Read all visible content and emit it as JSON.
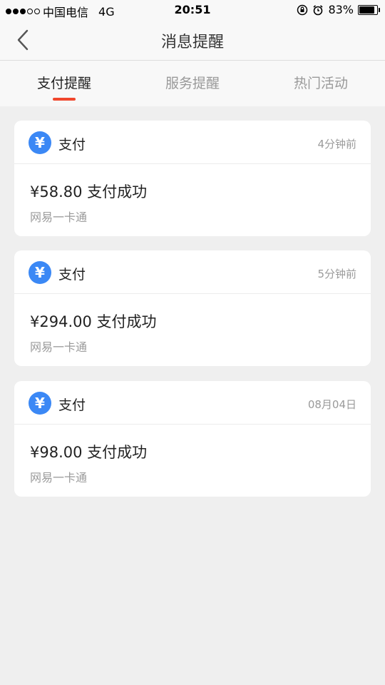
{
  "status_bar": {
    "carrier": "中国电信",
    "network": "4G",
    "time": "20:51",
    "battery": "83%"
  },
  "nav": {
    "title": "消息提醒"
  },
  "tabs": [
    {
      "label": "支付提醒",
      "active": true
    },
    {
      "label": "服务提醒",
      "active": false
    },
    {
      "label": "热门活动",
      "active": false
    }
  ],
  "messages": [
    {
      "icon": "yuan-icon",
      "icon_glyph": "¥",
      "type": "支付",
      "time": "4分钟前",
      "amount": "¥58.80 支付成功",
      "source": "网易一卡通"
    },
    {
      "icon": "yuan-icon",
      "icon_glyph": "¥",
      "type": "支付",
      "time": "5分钟前",
      "amount": "¥294.00 支付成功",
      "source": "网易一卡通"
    },
    {
      "icon": "yuan-icon",
      "icon_glyph": "¥",
      "type": "支付",
      "time": "08月04日",
      "amount": "¥98.00 支付成功",
      "source": "网易一卡通"
    }
  ],
  "colors": {
    "accent": "#f0472d",
    "icon_blue": "#3b88f5",
    "background": "#efefef"
  }
}
